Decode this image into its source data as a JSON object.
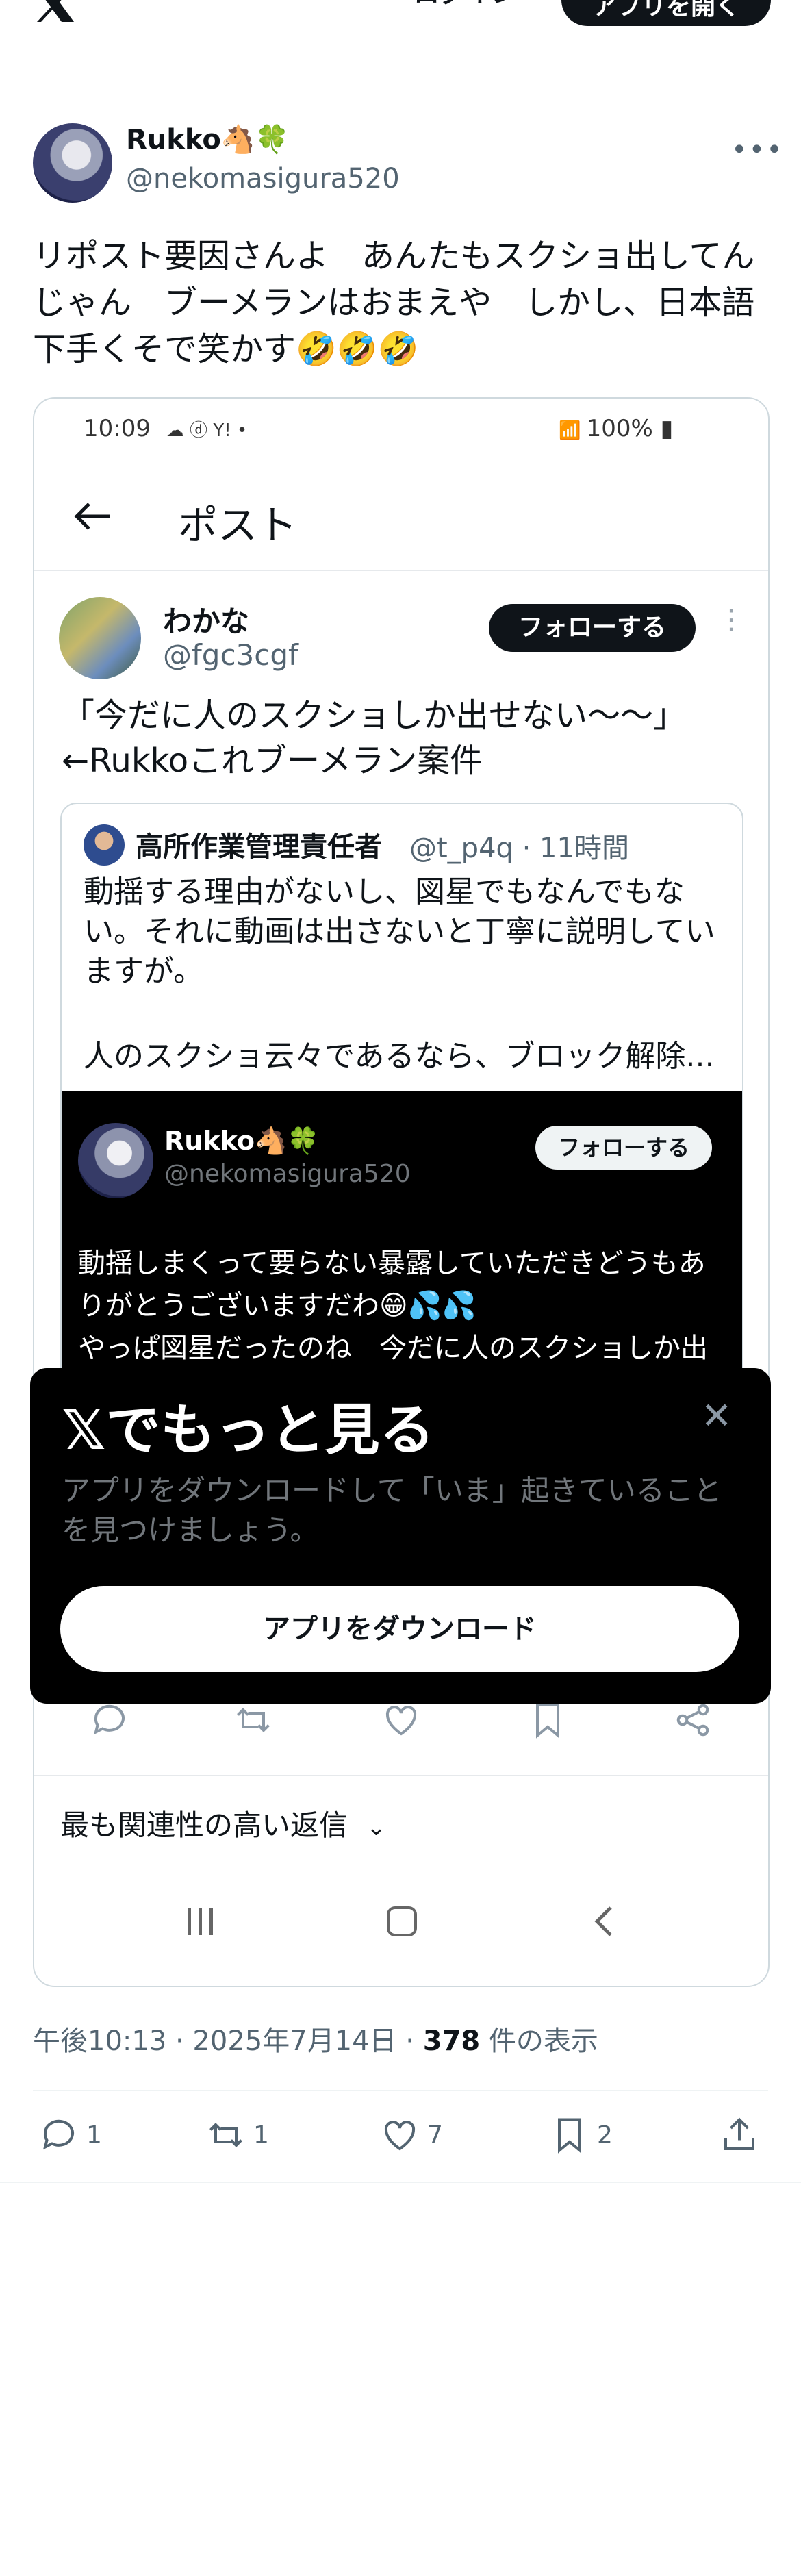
{
  "header": {
    "login_label": "ログイン",
    "open_app_label": "アプリを開く"
  },
  "tweet": {
    "author_name": "Rukko🐴🍀",
    "author_handle": "@nekomasigura520",
    "text": "リポスト要因さんよ　あんたもスクショ出してんじゃん　ブーメランはおまえや　しかし、日本語下手くそで笑かす🤣🤣🤣",
    "timestamp": "午後10:13 · 2025年7月14日 · ",
    "views_count": "378",
    "views_label": " 件の表示",
    "replies": "1",
    "reposts": "1",
    "likes": "7",
    "bookmarks": "2"
  },
  "embedded_screenshot": {
    "status_time": "10:09",
    "status_icons": "☁ ⓓ Y! •",
    "status_battery": "100%",
    "page_title": "ポスト",
    "post_author_name": "わかな",
    "post_author_handle": "@fgc3cgf",
    "follow_label": "フォローする",
    "post_text": "「今だに人のスクショしか出せない〜〜」←Rukkoこれブーメラン案件",
    "quote": {
      "author_name": "高所作業管理責任者",
      "author_handle_time": "@t_p4q · 11時間",
      "text": "動揺する理由がないし、図星でもなんでもない。それに動画は出さないと丁寧に説明していますが。",
      "text2": "人のスクショ云々であるなら、ブロック解除..."
    },
    "inner": {
      "author_name": "Rukko🐴🍀",
      "author_handle": "@nekomasigura520",
      "follow_label": "フォローする",
      "text": "動揺しまくって要らない暴露していただきどうもありがとうございますだわ😁💦💦\nやっぱ図星だったのね　今だに人のスクショしか出"
    },
    "most_relevant_label": "最も関連性の高い返信"
  },
  "prompt": {
    "title": "𝕏でもっと見る",
    "subtitle": "アプリをダウンロードして「いま」起きていることを見つけましょう。",
    "download_label": "アプリをダウンロード"
  },
  "colors": {
    "text": "#0f1419",
    "secondary": "#536471",
    "border": "#cfd9de",
    "black": "#000000",
    "white": "#ffffff"
  }
}
